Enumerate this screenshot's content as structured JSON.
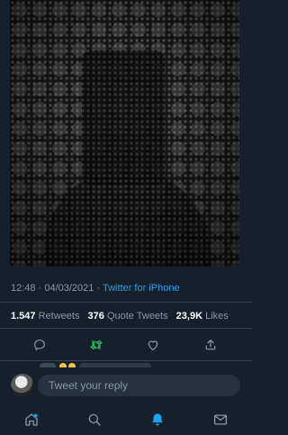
{
  "tweet": {
    "time": "12:48",
    "separator": "·",
    "date": "04/03/2021",
    "separator2": "·",
    "source": "Twitter for iPhone"
  },
  "stats": {
    "retweets_count": "1.547",
    "retweets_label": "Retweets",
    "quotes_count": "376",
    "quotes_label": "Quote Tweets",
    "likes_count": "23,9K",
    "likes_label": "Likes"
  },
  "actions": {
    "reply_icon": "comment-icon",
    "retweet_icon": "retweet-icon",
    "like_icon": "heart-icon",
    "share_icon": "share-icon"
  },
  "reply_bar": {
    "placeholder": "Tweet your reply"
  },
  "tabbar": {
    "items": [
      "home-icon",
      "search-icon",
      "notifications-icon",
      "messages-icon"
    ],
    "active": "notifications-icon"
  },
  "colors": {
    "background": "#15202b",
    "accent": "#1da1f2",
    "muted": "#8899a6",
    "retweet_active": "#17bf63",
    "divider": "#38444d"
  }
}
